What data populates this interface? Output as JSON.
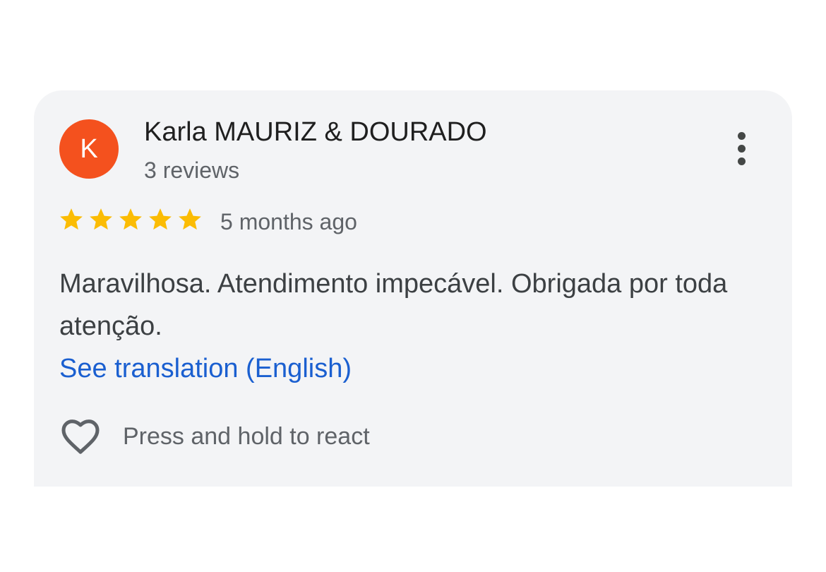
{
  "review": {
    "avatar_initial": "K",
    "avatar_color": "#f4511e",
    "author_name": "Karla MAURIZ & DOURADO",
    "review_count": "3 reviews",
    "rating": 5,
    "rating_max": 5,
    "star_color": "#fbbc04",
    "timestamp": "5 months ago",
    "text": "Maravilhosa. Atendimento impecável. Obrigada por toda atenção.",
    "translation_link": "See translation (English)",
    "react_prompt": "Press and hold to react",
    "more_icon": "more-vert-icon",
    "react_icon": "heart-outline-icon"
  }
}
